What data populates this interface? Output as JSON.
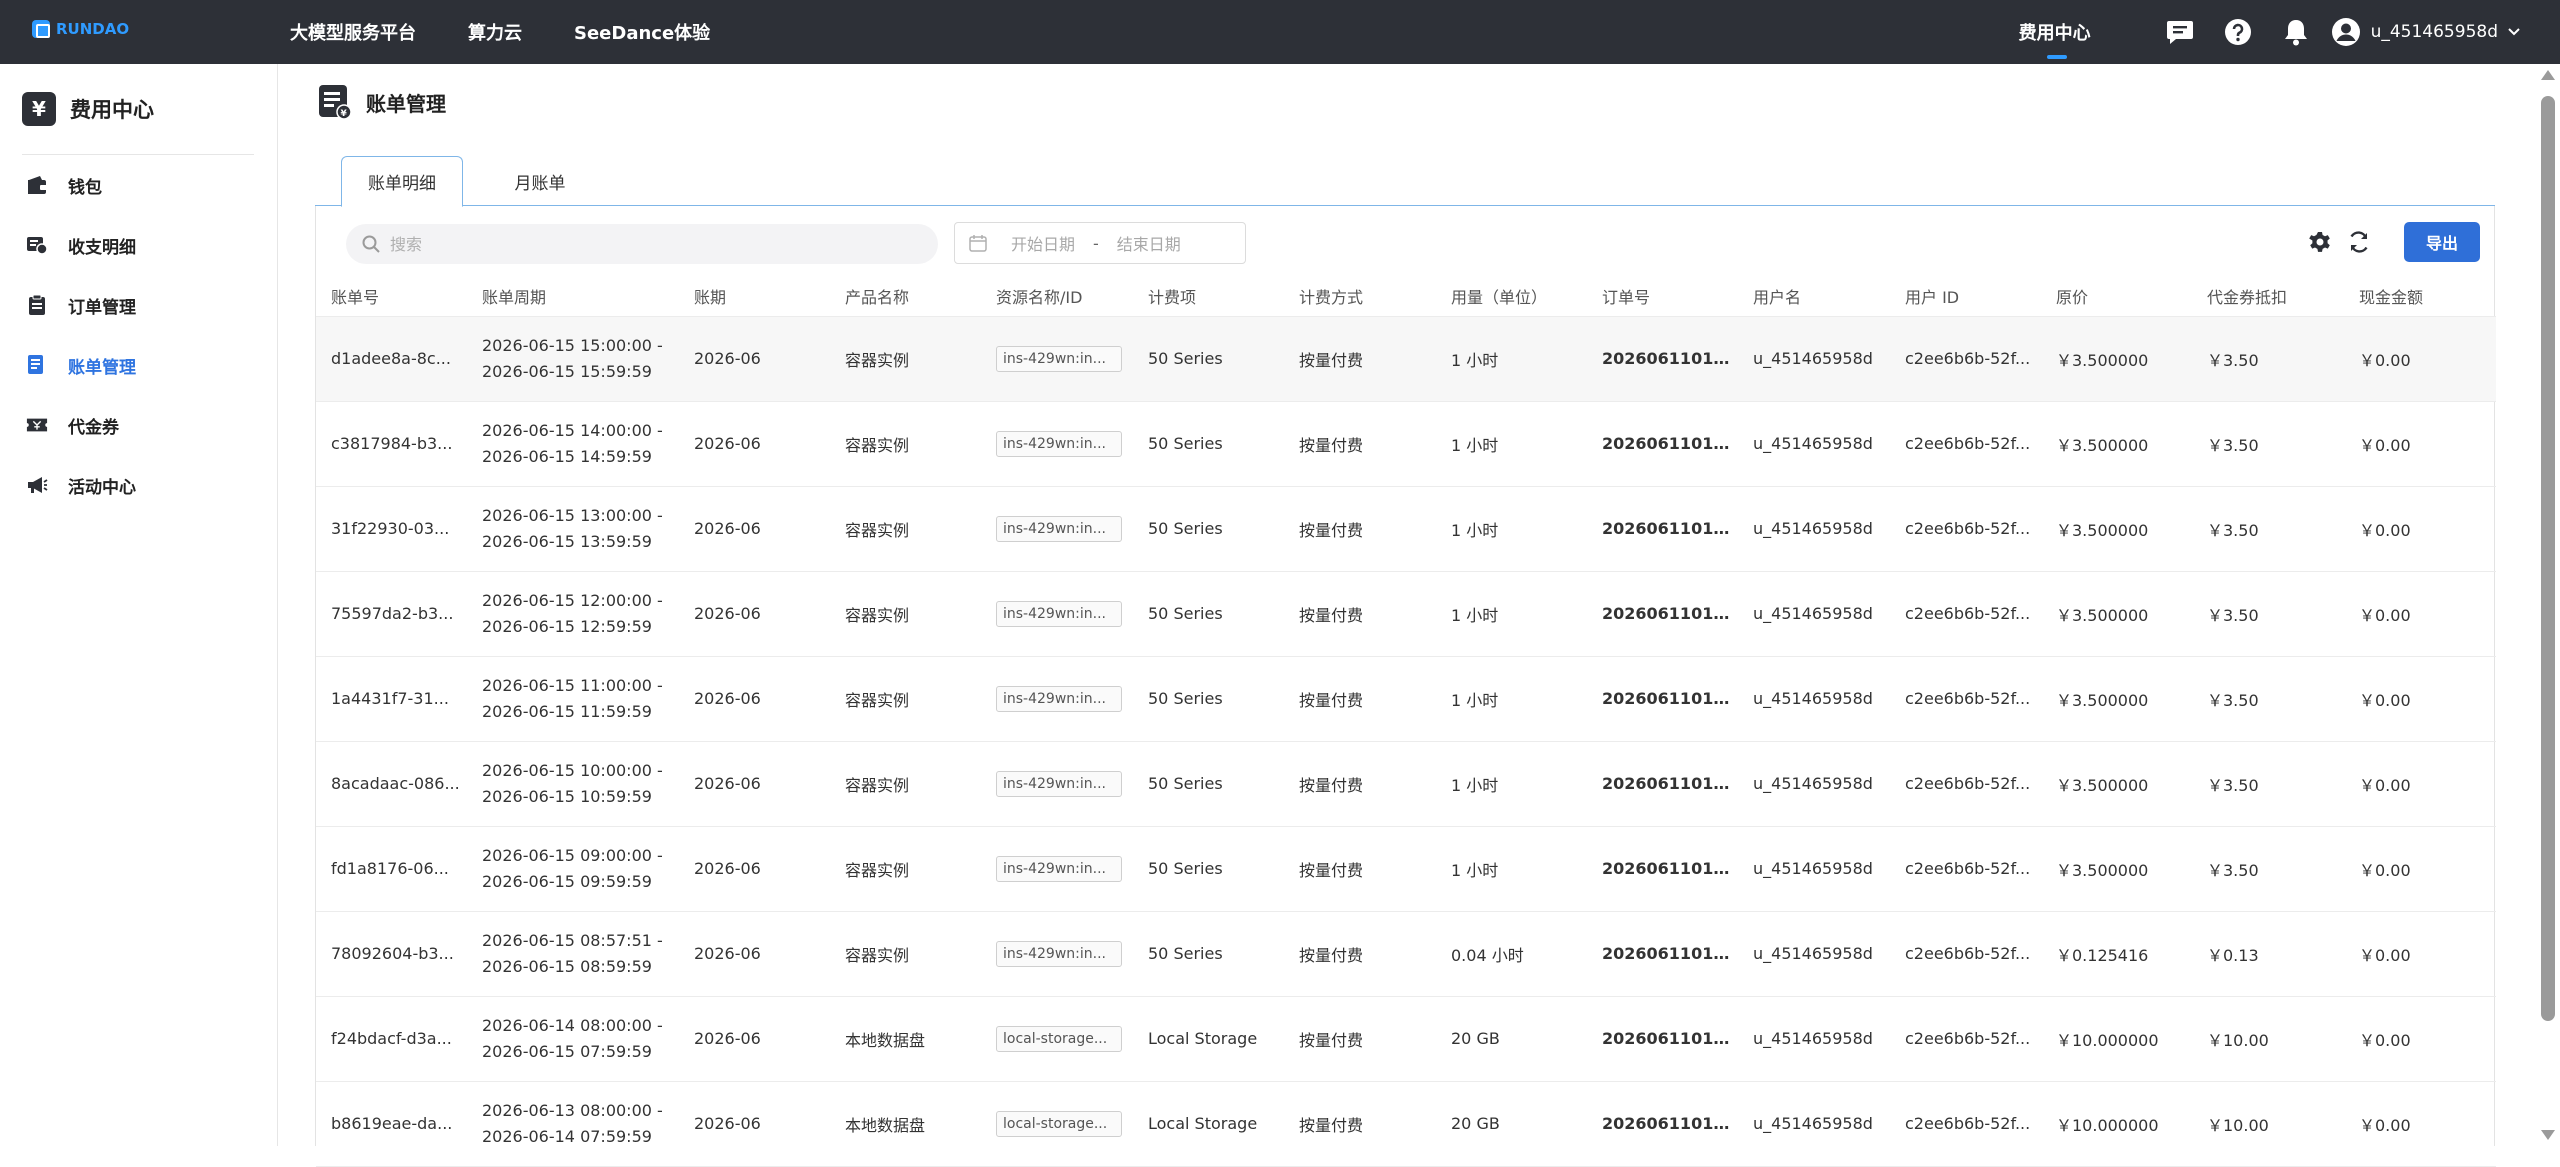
{
  "topbar": {
    "logo": "RUNDAO",
    "nav": [
      "大模型服务平台",
      "算力云",
      "SeeDance体验"
    ],
    "fee_center": "费用中心",
    "icons": [
      "message-icon",
      "help-icon",
      "bell-icon"
    ],
    "username": "u_451465958d"
  },
  "sidebar": {
    "title": "费用中心",
    "title_badge": "¥",
    "items": [
      {
        "label": "钱包",
        "icon": "wallet-icon",
        "active": false
      },
      {
        "label": "收支明细",
        "icon": "ledger-icon",
        "active": false
      },
      {
        "label": "订单管理",
        "icon": "clipboard-icon",
        "active": false
      },
      {
        "label": "账单管理",
        "icon": "bill-icon",
        "active": true
      },
      {
        "label": "代金券",
        "icon": "ticket-icon",
        "active": false
      },
      {
        "label": "活动中心",
        "icon": "megaphone-icon",
        "active": false
      }
    ]
  },
  "main": {
    "title": "账单管理",
    "tabs": [
      "账单明细",
      "月账单"
    ],
    "search_placeholder": "搜索",
    "date_start_placeholder": "开始日期",
    "date_separator": "-",
    "date_end_placeholder": "结束日期",
    "export_label": "导出"
  },
  "table": {
    "headers": [
      "账单号",
      "账单周期",
      "账期",
      "产品名称",
      "资源名称/ID",
      "计费项",
      "计费方式",
      "用量（单位）",
      "订单号",
      "用户名",
      "用户 ID",
      "原价",
      "代金券抵扣",
      "现金金额"
    ],
    "rows": [
      {
        "id": "d1adee8a-8c...",
        "p1": "2026-06-15 15:00:00",
        "p2": "2026-06-15 15:59:59",
        "term": "2026-06",
        "product": "容器实例",
        "resource": "ins-429wn:in...",
        "item": "50 Series",
        "method": "按量付费",
        "usage": "1 小时",
        "order": "20260611010...",
        "user": "u_451465958d",
        "uid": "c2ee6b6b-52f...",
        "price": "￥3.500000",
        "voucher": "￥3.50",
        "cash": "￥0.00"
      },
      {
        "id": "c3817984-b3...",
        "p1": "2026-06-15 14:00:00",
        "p2": "2026-06-15 14:59:59",
        "term": "2026-06",
        "product": "容器实例",
        "resource": "ins-429wn:in...",
        "item": "50 Series",
        "method": "按量付费",
        "usage": "1 小时",
        "order": "20260611010...",
        "user": "u_451465958d",
        "uid": "c2ee6b6b-52f...",
        "price": "￥3.500000",
        "voucher": "￥3.50",
        "cash": "￥0.00"
      },
      {
        "id": "31f22930-03...",
        "p1": "2026-06-15 13:00:00",
        "p2": "2026-06-15 13:59:59",
        "term": "2026-06",
        "product": "容器实例",
        "resource": "ins-429wn:in...",
        "item": "50 Series",
        "method": "按量付费",
        "usage": "1 小时",
        "order": "20260611010...",
        "user": "u_451465958d",
        "uid": "c2ee6b6b-52f...",
        "price": "￥3.500000",
        "voucher": "￥3.50",
        "cash": "￥0.00"
      },
      {
        "id": "75597da2-b3...",
        "p1": "2026-06-15 12:00:00",
        "p2": "2026-06-15 12:59:59",
        "term": "2026-06",
        "product": "容器实例",
        "resource": "ins-429wn:in...",
        "item": "50 Series",
        "method": "按量付费",
        "usage": "1 小时",
        "order": "20260611010...",
        "user": "u_451465958d",
        "uid": "c2ee6b6b-52f...",
        "price": "￥3.500000",
        "voucher": "￥3.50",
        "cash": "￥0.00"
      },
      {
        "id": "1a4431f7-31...",
        "p1": "2026-06-15 11:00:00",
        "p2": "2026-06-15 11:59:59",
        "term": "2026-06",
        "product": "容器实例",
        "resource": "ins-429wn:in...",
        "item": "50 Series",
        "method": "按量付费",
        "usage": "1 小时",
        "order": "20260611010...",
        "user": "u_451465958d",
        "uid": "c2ee6b6b-52f...",
        "price": "￥3.500000",
        "voucher": "￥3.50",
        "cash": "￥0.00"
      },
      {
        "id": "8acadaac-086...",
        "p1": "2026-06-15 10:00:00",
        "p2": "2026-06-15 10:59:59",
        "term": "2026-06",
        "product": "容器实例",
        "resource": "ins-429wn:in...",
        "item": "50 Series",
        "method": "按量付费",
        "usage": "1 小时",
        "order": "20260611010...",
        "user": "u_451465958d",
        "uid": "c2ee6b6b-52f...",
        "price": "￥3.500000",
        "voucher": "￥3.50",
        "cash": "￥0.00"
      },
      {
        "id": "fd1a8176-06...",
        "p1": "2026-06-15 09:00:00",
        "p2": "2026-06-15 09:59:59",
        "term": "2026-06",
        "product": "容器实例",
        "resource": "ins-429wn:in...",
        "item": "50 Series",
        "method": "按量付费",
        "usage": "1 小时",
        "order": "20260611010...",
        "user": "u_451465958d",
        "uid": "c2ee6b6b-52f...",
        "price": "￥3.500000",
        "voucher": "￥3.50",
        "cash": "￥0.00"
      },
      {
        "id": "78092604-b3...",
        "p1": "2026-06-15 08:57:51",
        "p2": "2026-06-15 08:59:59",
        "term": "2026-06",
        "product": "容器实例",
        "resource": "ins-429wn:in...",
        "item": "50 Series",
        "method": "按量付费",
        "usage": "0.04 小时",
        "order": "20260611010...",
        "user": "u_451465958d",
        "uid": "c2ee6b6b-52f...",
        "price": "￥0.125416",
        "voucher": "￥0.13",
        "cash": "￥0.00"
      },
      {
        "id": "f24bdacf-d3a...",
        "p1": "2026-06-14 08:00:00",
        "p2": "2026-06-15 07:59:59",
        "term": "2026-06",
        "product": "本地数据盘",
        "resource": "local-storage...",
        "item": "Local Storage",
        "method": "按量付费",
        "usage": "20 GB",
        "order": "20260611010...",
        "user": "u_451465958d",
        "uid": "c2ee6b6b-52f...",
        "price": "￥10.000000",
        "voucher": "￥10.00",
        "cash": "￥0.00"
      },
      {
        "id": "b8619eae-da...",
        "p1": "2026-06-13 08:00:00",
        "p2": "2026-06-14 07:59:59",
        "term": "2026-06",
        "product": "本地数据盘",
        "resource": "local-storage...",
        "item": "Local Storage",
        "method": "按量付费",
        "usage": "20 GB",
        "order": "20260611010...",
        "user": "u_451465958d",
        "uid": "c2ee6b6b-52f...",
        "price": "￥10.000000",
        "voucher": "￥10.00",
        "cash": "￥0.00"
      }
    ]
  },
  "colors": {
    "topbar": "#2d3037",
    "accent": "#2f6fd8",
    "active_nav": "#2f74e0"
  }
}
